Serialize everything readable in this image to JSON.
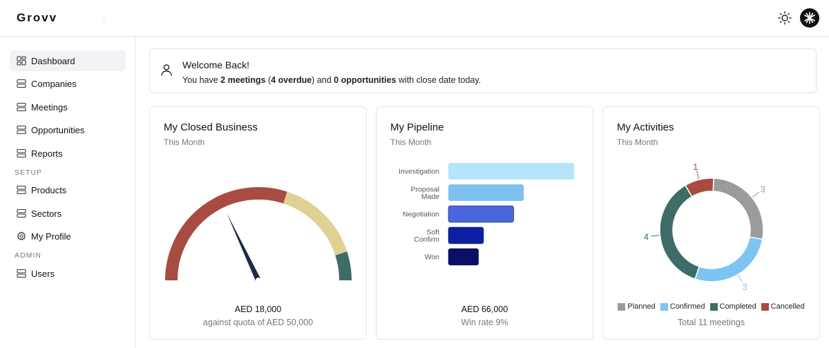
{
  "app": {
    "title": "Grovv"
  },
  "sidebar": {
    "items": [
      {
        "label": "Dashboard",
        "icon": "dashboard-icon",
        "active": true
      },
      {
        "label": "Companies",
        "icon": "server-icon"
      },
      {
        "label": "Meetings",
        "icon": "server-icon"
      },
      {
        "label": "Opportunities",
        "icon": "server-icon"
      },
      {
        "label": "Reports",
        "icon": "server-icon"
      },
      {
        "label": "Products",
        "icon": "server-icon"
      },
      {
        "label": "Sectors",
        "icon": "server-icon"
      },
      {
        "label": "My Profile",
        "icon": "gear-icon"
      },
      {
        "label": "Users",
        "icon": "server-icon"
      }
    ],
    "sections": {
      "setup": "SETUP",
      "admin": "ADMIN"
    }
  },
  "welcome": {
    "title": "Welcome Back!",
    "msg_prefix": "You have ",
    "meetings": "2 meetings",
    "open_paren": " (",
    "overdue": "4 overdue",
    "msg_mid": ") and ",
    "opportunities": "0 opportunities",
    "msg_suffix": " with close date today."
  },
  "cards": {
    "closed": {
      "title": "My Closed Business",
      "subtitle": "This Month",
      "amount": "AED 18,000",
      "quota": "against quota of AED 50,000"
    },
    "pipeline": {
      "title": "My Pipeline",
      "subtitle": "This Month",
      "amount": "AED 66,000",
      "win_rate": "Win rate 9%"
    },
    "activities": {
      "title": "My Activities",
      "subtitle": "This Month",
      "total": "Total 11 meetings"
    }
  },
  "colors": {
    "gauge_red": "#a84c42",
    "gauge_yellow": "#e0d194",
    "gauge_green": "#3d6d66",
    "needle": "#1c2d45",
    "funnel": [
      "#b6e4fa",
      "#7ec1f0",
      "#4a66db",
      "#0d1fa3",
      "#0a0f66"
    ],
    "planned": "#9b9b9b",
    "confirmed": "#7dc4f2",
    "completed": "#3d6d66",
    "cancelled": "#a84c42"
  },
  "chart_data": [
    {
      "type": "gauge",
      "value": 18000,
      "max": 50000,
      "bands": [
        {
          "color": "red",
          "from": 0,
          "to": 0.6
        },
        {
          "color": "yellow",
          "from": 0.6,
          "to": 0.9
        },
        {
          "color": "green",
          "from": 0.9,
          "to": 1.0
        }
      ]
    },
    {
      "type": "bar",
      "orientation": "horizontal",
      "categories": [
        "Investigation",
        "Proposal Made",
        "Negotiation",
        "Soft Confirm",
        "Won"
      ],
      "category_lines": [
        [
          "Investigation"
        ],
        [
          "Proposal",
          "Made"
        ],
        [
          "Negotiation"
        ],
        [
          "Soft",
          "Confirm"
        ],
        [
          "Won"
        ]
      ],
      "values": [
        100,
        60,
        52,
        28,
        24
      ]
    },
    {
      "type": "pie",
      "donut": true,
      "categories": [
        "Planned",
        "Confirmed",
        "Completed",
        "Cancelled"
      ],
      "values": [
        3,
        3,
        4,
        1
      ]
    }
  ]
}
